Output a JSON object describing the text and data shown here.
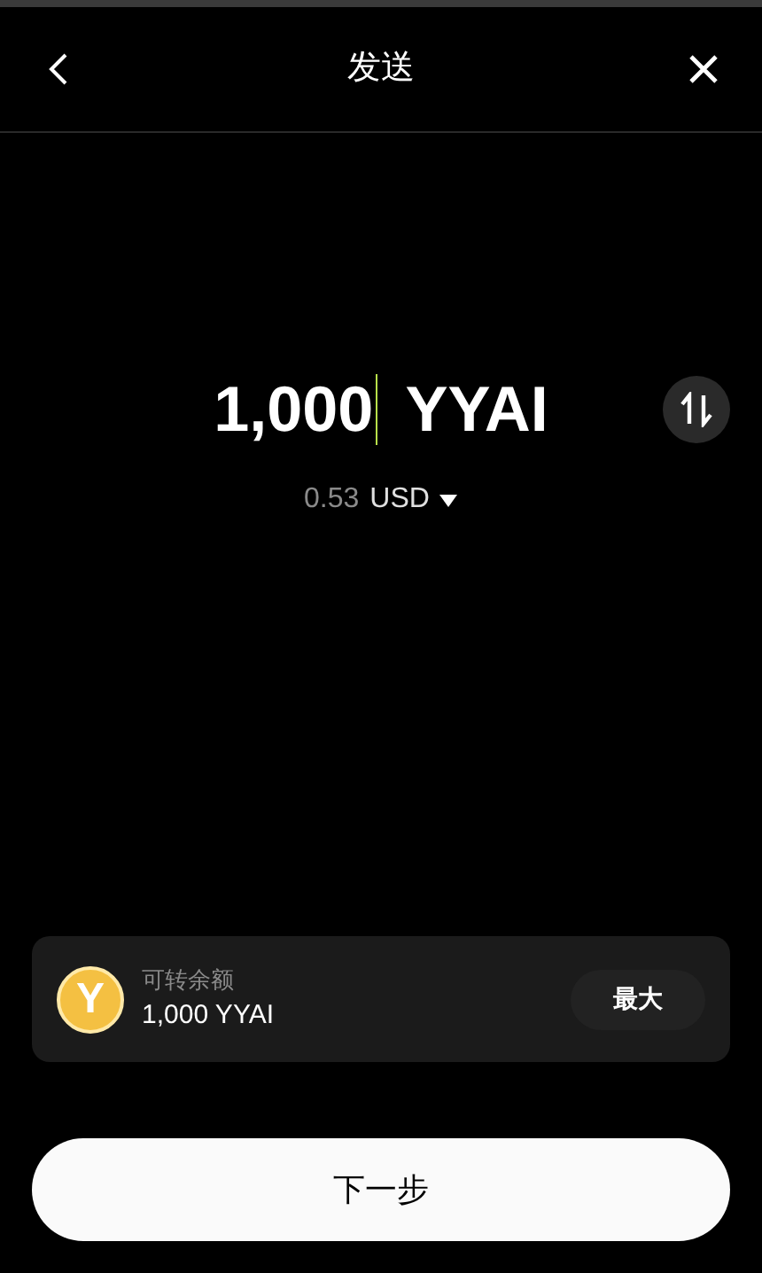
{
  "header": {
    "title": "发送"
  },
  "amount": {
    "value": "1,000",
    "unit": "YYAI"
  },
  "fiat": {
    "value": "0.53",
    "currency": "USD"
  },
  "balance": {
    "coin_letter": "Y",
    "label": "可转余额",
    "value": "1,000 YYAI",
    "max_button": "最大"
  },
  "next_button": "下一步"
}
